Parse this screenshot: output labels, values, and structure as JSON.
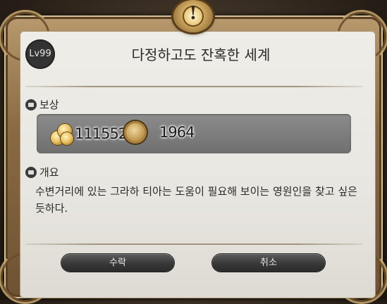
{
  "dialog": {
    "level": "Lv99",
    "title": "다정하고도 잔혹한 세계",
    "alert_mark": "!"
  },
  "rewards": {
    "label": "보상",
    "items": [
      {
        "icon": "gil-icon",
        "value": "1115520"
      },
      {
        "icon": "seal-icon",
        "value": "1964"
      }
    ]
  },
  "summary": {
    "label": "개요",
    "text": "수변거리에 있는 그라하 티아는 도움이 필요해 보이는 영원인을 찾고 싶은 듯하다."
  },
  "buttons": {
    "accept": "수락",
    "cancel": "취소"
  }
}
